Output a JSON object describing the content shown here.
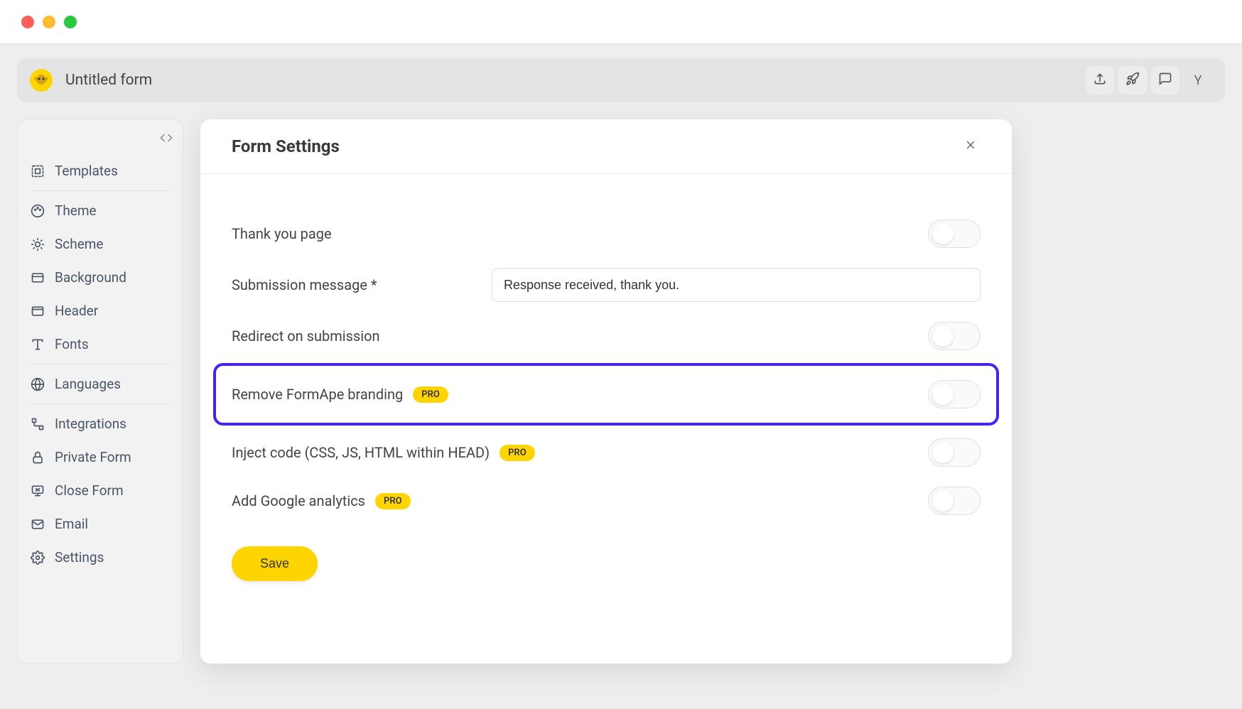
{
  "header": {
    "title": "Untitled form",
    "avatar_initial": "Y"
  },
  "sidebar": {
    "items": [
      {
        "label": "Templates"
      },
      {
        "label": "Theme"
      },
      {
        "label": "Scheme"
      },
      {
        "label": "Background"
      },
      {
        "label": "Header"
      },
      {
        "label": "Fonts"
      },
      {
        "label": "Languages"
      },
      {
        "label": "Integrations"
      },
      {
        "label": "Private Form"
      },
      {
        "label": "Close Form"
      },
      {
        "label": "Email"
      },
      {
        "label": "Settings"
      }
    ]
  },
  "modal": {
    "title": "Form Settings",
    "settings": {
      "thank_you": {
        "label": "Thank you page"
      },
      "submission_message": {
        "label": "Submission message *",
        "value": "Response received, thank you."
      },
      "redirect": {
        "label": "Redirect on submission"
      },
      "remove_branding": {
        "label": "Remove FormApe branding",
        "badge": "PRO"
      },
      "inject_code": {
        "label": "Inject code (CSS, JS, HTML within HEAD)",
        "badge": "PRO"
      },
      "google_analytics": {
        "label": "Add Google analytics",
        "badge": "PRO"
      }
    },
    "save_label": "Save"
  }
}
